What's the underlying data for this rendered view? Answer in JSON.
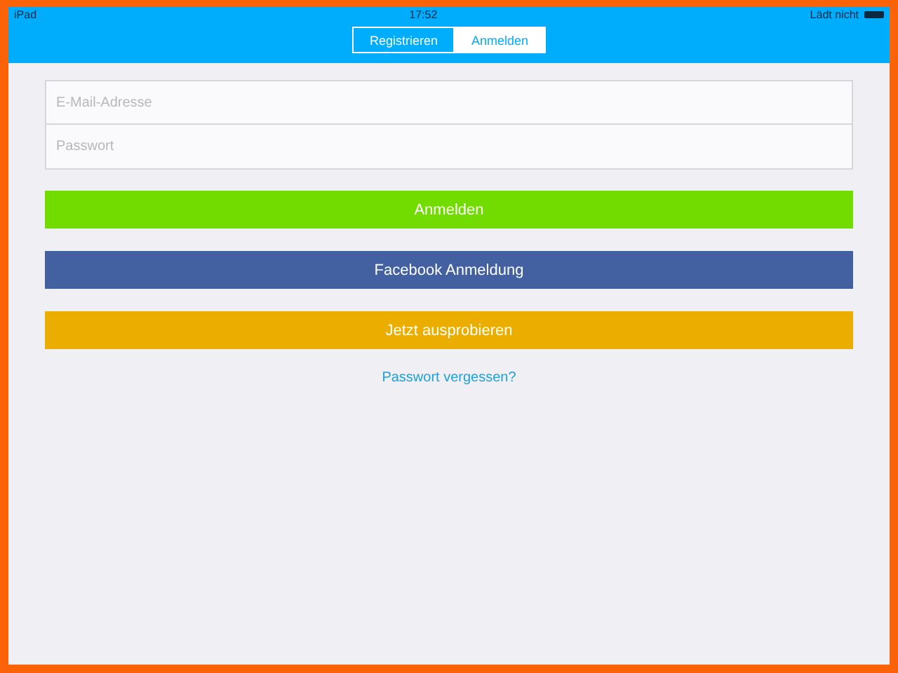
{
  "status_bar": {
    "device": "iPad",
    "time": "17:52",
    "battery": "Lädt nicht"
  },
  "tabs": [
    {
      "label": "Registrieren",
      "selected": false
    },
    {
      "label": "Anmelden",
      "selected": true
    }
  ],
  "fields": [
    {
      "placeholder": "E-Mail-Adresse"
    },
    {
      "placeholder": "Passwort"
    }
  ],
  "buttons": [
    {
      "label": "Anmelden",
      "color": "#72dc00"
    },
    {
      "label": "Facebook Anmeldung",
      "color": "#4360a1"
    },
    {
      "label": "Jetzt ausprobieren",
      "color": "#eaad00"
    }
  ],
  "link": "Passwort vergessen?"
}
